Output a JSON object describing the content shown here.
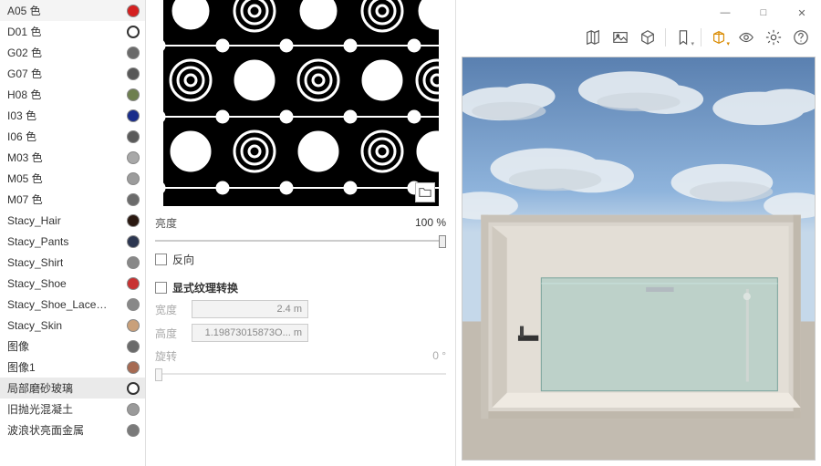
{
  "materials": [
    {
      "name": "A05 色",
      "color": "#d42020"
    },
    {
      "name": "D01 色",
      "color": "#f0e6b8",
      "ring": true
    },
    {
      "name": "G02 色",
      "color": "#6a6a6a"
    },
    {
      "name": "G07 色",
      "color": "#575757"
    },
    {
      "name": "H08 色",
      "color": "#6e7f4f"
    },
    {
      "name": "I03 色",
      "color": "#1a2d8a"
    },
    {
      "name": "I06 色",
      "color": "#5a5a5a"
    },
    {
      "name": "M03 色",
      "color": "#a8a8a8"
    },
    {
      "name": "M05 色",
      "color": "#9c9c9c"
    },
    {
      "name": "M07 色",
      "color": "#6b6b6b"
    },
    {
      "name": "Stacy_Hair",
      "color": "#2a1810"
    },
    {
      "name": "Stacy_Pants",
      "color": "#2c3650"
    },
    {
      "name": "Stacy_Shirt",
      "color": "#888"
    },
    {
      "name": "Stacy_Shoe",
      "color": "#c83232"
    },
    {
      "name": "Stacy_Shoe_Laces_S...",
      "color": "#888"
    },
    {
      "name": "Stacy_Skin",
      "color": "#c9a07a"
    },
    {
      "name": "图像",
      "color": "#6a6a6a"
    },
    {
      "name": "图像1",
      "color": "#a66a52"
    },
    {
      "name": "局部磨砂玻璃",
      "color": "#fff",
      "ring": true,
      "selected": true
    },
    {
      "name": "旧抛光混凝土",
      "color": "#9a9a9a"
    },
    {
      "name": "波浪状亮面金属",
      "color": "#7a7a7a"
    }
  ],
  "brightness": {
    "label": "亮度",
    "value": "100 %",
    "pos": 100
  },
  "reverse": {
    "label": "反向",
    "checked": false
  },
  "explicit": {
    "label": "显式纹理转换",
    "checked": false
  },
  "width": {
    "label": "宽度",
    "value": "2.4 m"
  },
  "height": {
    "label": "高度",
    "value": "1.19873015873O... m"
  },
  "rotation": {
    "label": "旋转",
    "value": "0 °",
    "pos": 0
  },
  "win": {
    "min": "—",
    "max": "□",
    "close": "✕"
  }
}
